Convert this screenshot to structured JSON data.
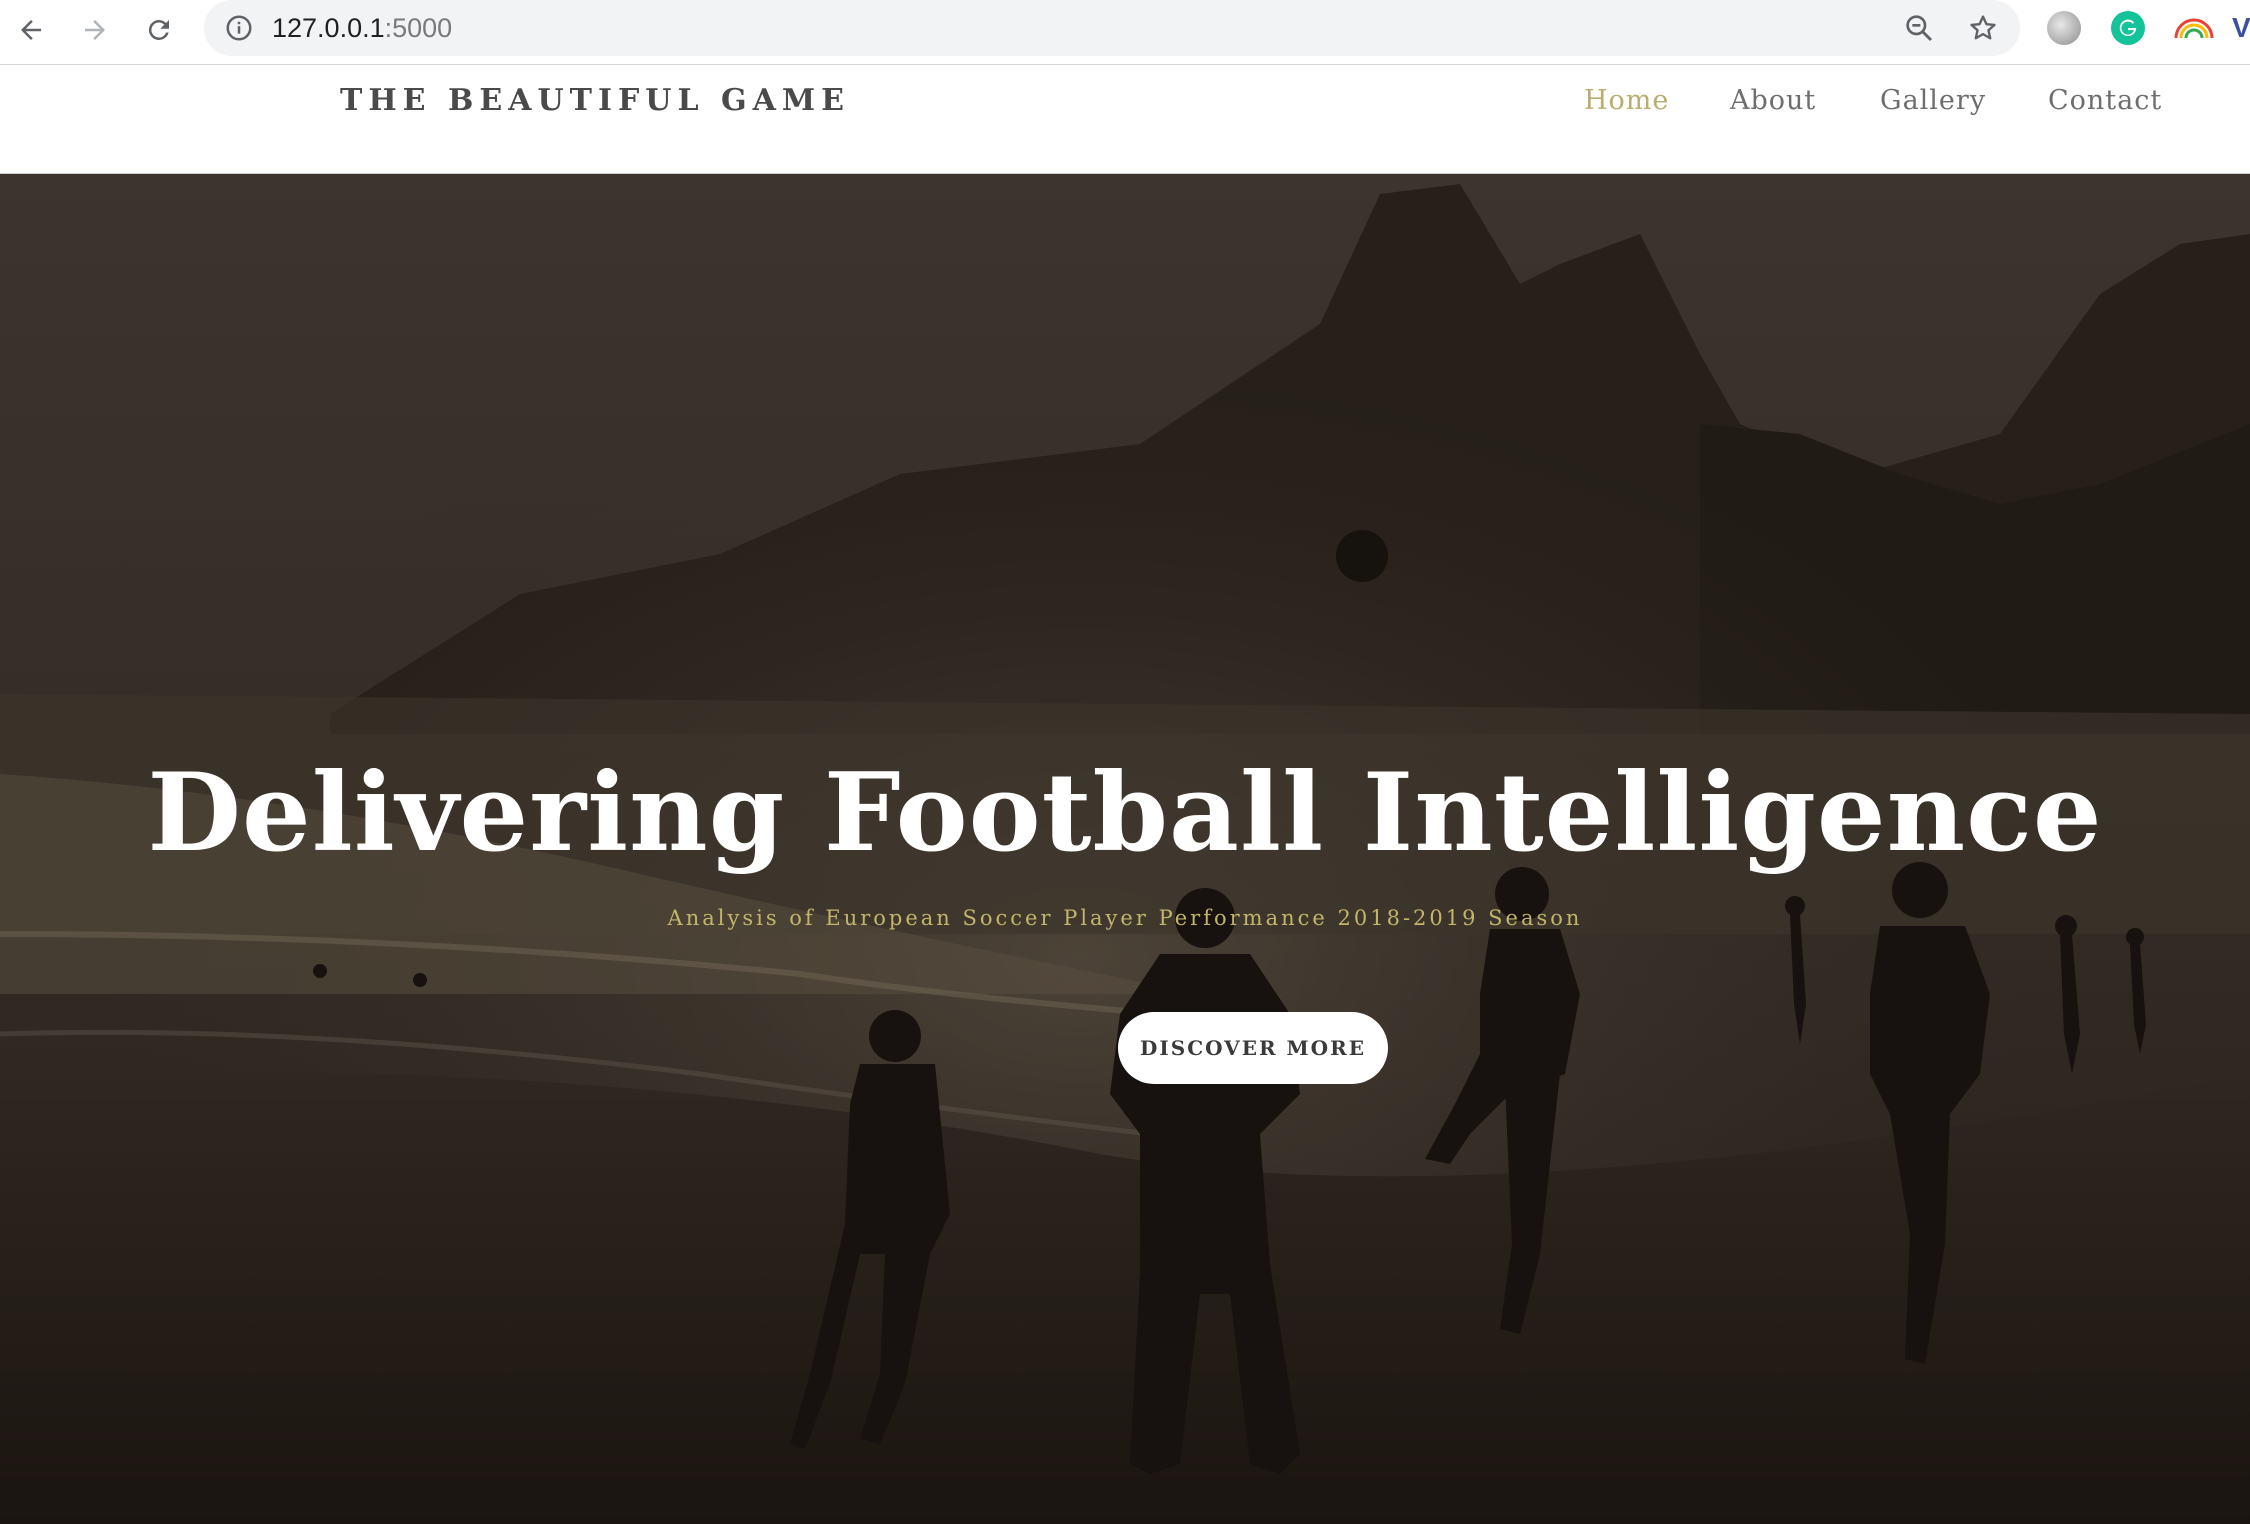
{
  "browser": {
    "url_host": "127.0.0.1",
    "url_port": ":5000",
    "icons": [
      "back-arrow-icon",
      "forward-arrow-icon",
      "reload-icon",
      "info-icon",
      "zoom-out-icon",
      "star-icon",
      "extension-circle-icon",
      "grammarly-icon",
      "rainbow-extension-icon"
    ]
  },
  "site": {
    "brand": "THE BEAUTIFUL GAME",
    "nav": [
      {
        "label": "Home",
        "active": true
      },
      {
        "label": "About",
        "active": false
      },
      {
        "label": "Gallery",
        "active": false
      },
      {
        "label": "Contact",
        "active": false
      }
    ]
  },
  "hero": {
    "title": "Delivering Football Intelligence",
    "subtitle": "Analysis of European Soccer Player Performance 2018-2019 Season",
    "cta_label": "DISCOVER MORE"
  },
  "colors": {
    "accent": "#b9ae6e",
    "subtitle": "#c3b56a",
    "nav_text": "#6e6e6e",
    "hero_bg": "#3a3129"
  }
}
